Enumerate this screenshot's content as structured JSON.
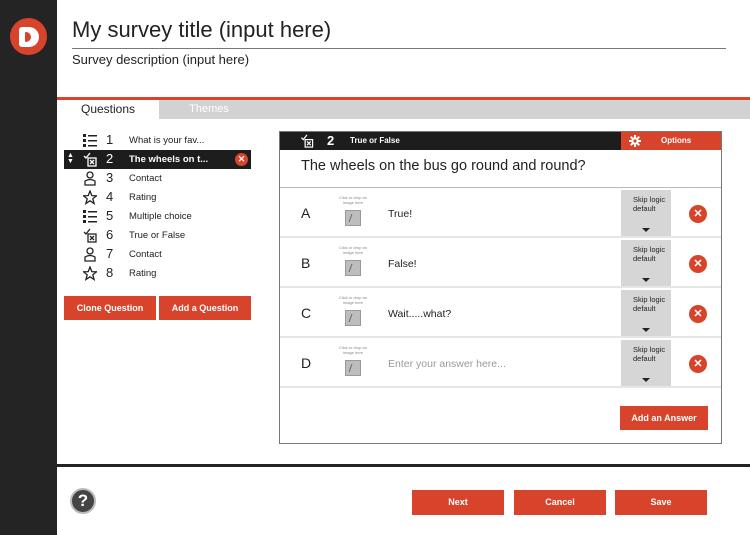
{
  "header": {
    "title": "My survey title (input here)",
    "description": "Survey description (input here)"
  },
  "tabs": [
    {
      "label": "Questions"
    },
    {
      "label": "Themes"
    }
  ],
  "questions": [
    {
      "num": "1",
      "label": "What is your fav...",
      "icon": "list-icon"
    },
    {
      "num": "2",
      "label": "The wheels on t...",
      "icon": "true-false-icon"
    },
    {
      "num": "3",
      "label": "Contact",
      "icon": "contact-icon"
    },
    {
      "num": "4",
      "label": "Rating",
      "icon": "star-icon"
    },
    {
      "num": "5",
      "label": "Multiple choice",
      "icon": "list-icon"
    },
    {
      "num": "6",
      "label": "True or False",
      "icon": "true-false-icon"
    },
    {
      "num": "7",
      "label": "Contact",
      "icon": "contact-icon"
    },
    {
      "num": "8",
      "label": "Rating",
      "icon": "star-icon"
    }
  ],
  "actions": {
    "clone_question": "Clone Question",
    "add_question": "Add a Question"
  },
  "editor": {
    "num": "2",
    "type": "True or False",
    "options_label": "Options",
    "question_text": "The wheels on the bus go round and round?",
    "image_hint": "Click or drop an image here",
    "answers": [
      {
        "letter": "A",
        "text": "True!",
        "skip": "Skip logic default"
      },
      {
        "letter": "B",
        "text": "False!",
        "skip": "Skip logic default"
      },
      {
        "letter": "C",
        "text": "Wait.....what?",
        "skip": "Skip logic default"
      },
      {
        "letter": "D",
        "placeholder": "Enter your answer here...",
        "skip": "Skip logic default"
      }
    ],
    "add_answer": "Add an Answer"
  },
  "footer": {
    "help": "?",
    "next": "Next",
    "cancel": "Cancel",
    "save": "Save"
  },
  "colors": {
    "accent": "#d8442b",
    "dark": "#1d1d1d"
  }
}
